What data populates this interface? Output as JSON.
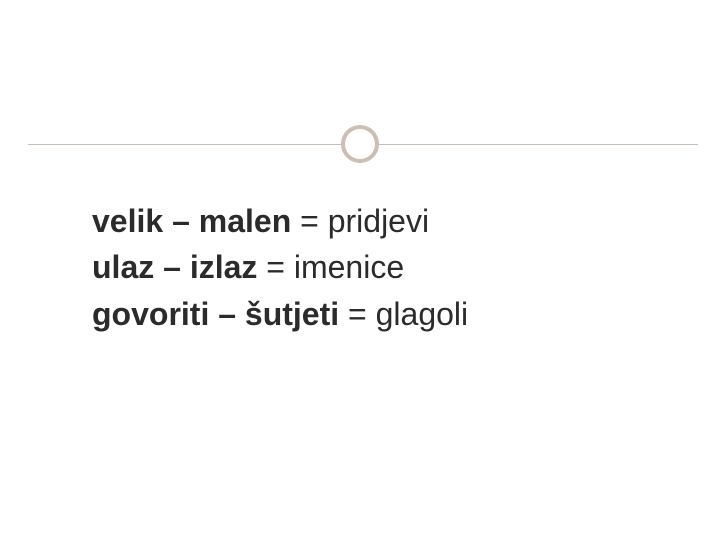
{
  "entries": [
    {
      "pair": "velik – malen",
      "eq": " = ",
      "category": "pridjevi"
    },
    {
      "pair": "ulaz – izlaz",
      "eq": " = ",
      "category": "imenice"
    },
    {
      "pair": "govoriti – šutjeti",
      "eq": " = ",
      "category": "glagoli"
    }
  ]
}
